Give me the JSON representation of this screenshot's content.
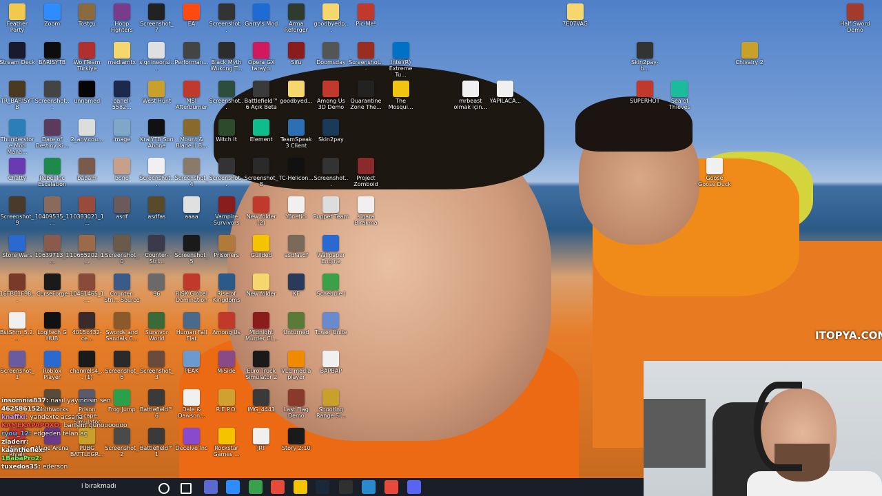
{
  "desktop_icons": [
    {
      "label": "Feather Party",
      "color": "#f2c94c"
    },
    {
      "label": "Zoom",
      "color": "#2d8cff"
    },
    {
      "label": "Tostçu",
      "color": "#8b6a3e"
    },
    {
      "label": "Hoop Fighters",
      "color": "#7a3b8a"
    },
    {
      "label": "Screenshot_7",
      "color": "#222222"
    },
    {
      "label": "EA",
      "color": "#ff4a12"
    },
    {
      "label": "Screenshot...",
      "color": "#333333"
    },
    {
      "label": "Garry's Mod",
      "color": "#1e6bd6"
    },
    {
      "label": "Arma Reforger",
      "color": "#2f3b2f"
    },
    {
      "label": "goodbyedp...",
      "color": "#f5d76e"
    },
    {
      "label": "Pic-Me!",
      "color": "#c0392b"
    },
    {
      "label": "7E07VAG",
      "color": "#f5d76e"
    },
    {
      "label": "Half Sword Demo",
      "color": "#a33a2a"
    },
    {
      "label": "Stream Deck",
      "color": "#1a1a2e"
    },
    {
      "label": "BARISYTB",
      "color": "#0d0d0d"
    },
    {
      "label": "WolfTeam Türkiye",
      "color": "#b03030"
    },
    {
      "label": "mediamtx",
      "color": "#f5d76e"
    },
    {
      "label": "signineonsi...",
      "color": "#e0e0e0"
    },
    {
      "label": "Performan...",
      "color": "#444444"
    },
    {
      "label": "Black Myth Wukong T...",
      "color": "#2c2c2c"
    },
    {
      "label": "Opera GX taraycı",
      "color": "#d3195e"
    },
    {
      "label": "Sifu",
      "color": "#8a1c1c"
    },
    {
      "label": "Doomsday",
      "color": "#555555"
    },
    {
      "label": "Screenshot...",
      "color": "#9b2d20"
    },
    {
      "label": "Intel(R) Extreme Tu...",
      "color": "#0071c5"
    },
    {
      "label": "Skin2pay-b...",
      "color": "#333333"
    },
    {
      "label": "Chivalry 2",
      "color": "#c8a02a"
    },
    {
      "label": "TR_BARISYTB",
      "color": "#4a3a20"
    },
    {
      "label": "Screenshot...",
      "color": "#444444"
    },
    {
      "label": "unnamed",
      "color": "#050505"
    },
    {
      "label": "panel-5582...",
      "color": "#1b2a4a"
    },
    {
      "label": "West Hunt",
      "color": "#c8a02a"
    },
    {
      "label": "MSI Afterburner",
      "color": "#c0392b"
    },
    {
      "label": "Screenshot...",
      "color": "#2d4d3d"
    },
    {
      "label": "Battlefield™ 6 Açık Beta",
      "color": "#3a3a3a"
    },
    {
      "label": "goodbyed...",
      "color": "#f5d76e"
    },
    {
      "label": "Among Us 3D Demo",
      "color": "#c0392b"
    },
    {
      "label": "Quarantine Zone The...",
      "color": "#222222"
    },
    {
      "label": "The Mosqui...",
      "color": "#f1c40f"
    },
    {
      "label": "mrbeast olmak için...",
      "color": "#f0f0f0"
    },
    {
      "label": "YAPILACA...",
      "color": "#f0f0f0"
    },
    {
      "label": "SUPERHOT",
      "color": "#c0392b"
    },
    {
      "label": "Sea of Thieves",
      "color": "#1abc9c"
    },
    {
      "label": "Thunderstore Mod Mana...",
      "color": "#2980b9"
    },
    {
      "label": "Date of Destiny Ki...",
      "color": "#5b3a5b"
    },
    {
      "label": "2_any.cou...",
      "color": "#dddddd"
    },
    {
      "label": "image",
      "color": "#7fa8c8"
    },
    {
      "label": "KralYTB Son Abone",
      "color": "#111111"
    },
    {
      "label": "Mount & Blade II B...",
      "color": "#8a6a2a"
    },
    {
      "label": "Witch It",
      "color": "#2d4a2d"
    },
    {
      "label": "Element",
      "color": "#0dbd8b"
    },
    {
      "label": "TeamSpeak 3 Client",
      "color": "#2c6fb5"
    },
    {
      "label": "Skin2pay",
      "color": "#1b3a5a"
    },
    {
      "label": "Chatty",
      "color": "#6a3ab0"
    },
    {
      "label": "Rebel Inc Escalation",
      "color": "#1e8a4a"
    },
    {
      "label": "babam",
      "color": "#7a5a4a"
    },
    {
      "label": "bono",
      "color": "#c8a08a"
    },
    {
      "label": "Screenshot...",
      "color": "#f0f0f0"
    },
    {
      "label": "Screenshot_4",
      "color": "#8a7a6a"
    },
    {
      "label": "Screenshot...",
      "color": "#333333"
    },
    {
      "label": "Screenshot_8",
      "color": "#2a2a2a"
    },
    {
      "label": "TC-Helicon...",
      "color": "#111111"
    },
    {
      "label": "Screenshot...",
      "color": "#333333"
    },
    {
      "label": "Project Zomboid",
      "color": "#8a2a2a"
    },
    {
      "label": "Goose Goose Duck",
      "color": "#f0f0f0"
    },
    {
      "label": "Screenshot_9",
      "color": "#4a3a2a"
    },
    {
      "label": "10409535_1...",
      "color": "#8a6a5a"
    },
    {
      "label": "10383021_1...",
      "color": "#9a4a3a"
    },
    {
      "label": "asdf",
      "color": "#6a5a5a"
    },
    {
      "label": "asdfas",
      "color": "#5a4a2a"
    },
    {
      "label": "aaaa",
      "color": "#e0e0e0"
    },
    {
      "label": "Vampire Survivors",
      "color": "#8a1c1c"
    },
    {
      "label": "New folder (2)",
      "color": "#c0392b"
    },
    {
      "label": "Yönetici",
      "color": "#f0f0f0"
    },
    {
      "label": "Puppet Team",
      "color": "#dddddd"
    },
    {
      "label": "sigara Bırakma",
      "color": "#f0f0f0"
    },
    {
      "label": "Store Wars",
      "color": "#2a6ad0"
    },
    {
      "label": "10639713_1...",
      "color": "#8a5a4a"
    },
    {
      "label": "10665202_1...",
      "color": "#9a6a4a"
    },
    {
      "label": "Screenshot_0",
      "color": "#6a5a4a"
    },
    {
      "label": "Counter-Stri...",
      "color": "#3a3a4a"
    },
    {
      "label": "Screenshot_5",
      "color": "#1a1a1a"
    },
    {
      "label": "Prisoners",
      "color": "#b07a3a"
    },
    {
      "label": "Guilded",
      "color": "#f5c400"
    },
    {
      "label": "asdfasdf",
      "color": "#7a6a5a"
    },
    {
      "label": "Wallpaper Engine",
      "color": "#2a6ad0"
    },
    {
      "label": "16FBC1F98...",
      "color": "#7a3a2a"
    },
    {
      "label": "CurseForge",
      "color": "#1a1a1a"
    },
    {
      "label": "10461465_1...",
      "color": "#8a4a3a"
    },
    {
      "label": "Counter-Stri... Source",
      "color": "#3a5a8a"
    },
    {
      "label": "96",
      "color": "#6a6a6a"
    },
    {
      "label": "RISK Global Domination",
      "color": "#c0392b"
    },
    {
      "label": "Rise of Kingdoms",
      "color": "#2a5a8a"
    },
    {
      "label": "New folder",
      "color": "#f5d76e"
    },
    {
      "label": "KF",
      "color": "#2a3a5a"
    },
    {
      "label": "Schedule I",
      "color": "#3aa04a"
    },
    {
      "label": "BstShm_5.2...",
      "color": "#f0f0f0"
    },
    {
      "label": "Logitech G HUB",
      "color": "#111111"
    },
    {
      "label": "4015c432-ce...",
      "color": "#3a2a2a"
    },
    {
      "label": "Swords and Sandals C...",
      "color": "#8a5a2a"
    },
    {
      "label": "Survivor World",
      "color": "#3a6a3a"
    },
    {
      "label": "Human Fall Flat",
      "color": "#4a6a8a"
    },
    {
      "label": "Among Us",
      "color": "#c0392b"
    },
    {
      "label": "Midnight Murder Cl...",
      "color": "#8a1c1c"
    },
    {
      "label": "Unturned",
      "color": "#5a7a3a"
    },
    {
      "label": "Tower Unite",
      "color": "#6a8ad0"
    },
    {
      "label": "Screenshot_1",
      "color": "#6a5aa0"
    },
    {
      "label": "Roblox Player",
      "color": "#2a6ad0"
    },
    {
      "label": "channels4_... (1)",
      "color": "#1a1a1a"
    },
    {
      "label": "Screenshot_6",
      "color": "#2a2a2a"
    },
    {
      "label": "Screenshot_3",
      "color": "#6a4a3a"
    },
    {
      "label": "PEAK",
      "color": "#6a9ad0"
    },
    {
      "label": "MiSide",
      "color": "#8a4a8a"
    },
    {
      "label": "Euro Truck Simulator 2",
      "color": "#1a1a1a"
    },
    {
      "label": "VLC media player",
      "color": "#f08a00"
    },
    {
      "label": "BAPBAP",
      "color": "#f0f0f0"
    },
    {
      "label": "Smithworks",
      "color": "#5a4a3a"
    },
    {
      "label": "Prison Escape Simulator D...",
      "color": "#5a5a6a"
    },
    {
      "label": "Frog Jump",
      "color": "#2aa04a"
    },
    {
      "label": "Battlefield™ 6",
      "color": "#3a3a3a"
    },
    {
      "label": "Dale & Dawson...",
      "color": "#f0f0f0"
    },
    {
      "label": "R.E.P.O.",
      "color": "#d0a030"
    },
    {
      "label": "IMG_4441",
      "color": "#3a3a3a"
    },
    {
      "label": "Last Flag Demo",
      "color": "#8a3a2a"
    },
    {
      "label": "Shooting Range Si...",
      "color": "#c8a02a"
    },
    {
      "label": "PUBG BATTLEGR...",
      "color": "#c8a02a"
    },
    {
      "label": "Screenshot_2",
      "color": "#4a4a4a"
    },
    {
      "label": "Battlefield™ 1",
      "color": "#3a3a3a"
    },
    {
      "label": "Deceive Inc",
      "color": "#8a4ad0"
    },
    {
      "label": "Rockstar Games ...",
      "color": "#f5c400"
    },
    {
      "label": "JRT",
      "color": "#f0f0f0"
    },
    {
      "label": "Story 2:10",
      "color": "#1a1a1a"
    },
    {
      "label": "Mage Arena",
      "color": "#6a3a8a"
    },
    {
      "label": "Marvel Rivals",
      "color": "#c0392b"
    }
  ],
  "watermark": "ITOPYA.COM",
  "chat": [
    {
      "user": "insomnia837",
      "message": "nasıl yayıncısın sen",
      "color": "#ffffff"
    },
    {
      "user": "462586152",
      "message": "",
      "color": "#ffffff"
    },
    {
      "user": "knaffxi",
      "message": "yandexte acsana",
      "color": "#c89aff"
    },
    {
      "user": "KAMEKAPAPOXO",
      "message": "barışım günooooooo",
      "color": "#ff4a4a"
    },
    {
      "user": "ryou_12",
      "message": "edgeden felan aç",
      "color": "#6ab0ff"
    },
    {
      "user": "zladerr",
      "message": "",
      "color": "#ffffff"
    },
    {
      "user": "kaantheflex",
      "message": "",
      "color": "#ffffff"
    },
    {
      "user": "1BabaPro2",
      "message": "",
      "color": "#6aff6a"
    },
    {
      "user": "tuxedos35",
      "message": "ederson",
      "color": "#ffffff"
    }
  ],
  "taskbar": {
    "notice": "i bırakmadı",
    "apps": [
      {
        "name": "start-icon",
        "color": "#ffffff"
      },
      {
        "name": "search-icon",
        "color": "#ffffff"
      },
      {
        "name": "task-view-icon",
        "color": "#ffffff"
      },
      {
        "name": "app-icon-1",
        "color": "#5a6ad0"
      },
      {
        "name": "app-icon-2",
        "color": "#2d8cff"
      },
      {
        "name": "calculator-icon",
        "color": "#3aa04a"
      },
      {
        "name": "chrome-icon",
        "color": "#e84a3a"
      },
      {
        "name": "folder-icon",
        "color": "#f5c400"
      },
      {
        "name": "steam-icon",
        "color": "#1b2838"
      },
      {
        "name": "obs-icon",
        "color": "#303030"
      },
      {
        "name": "app-icon-3",
        "color": "#2a8ad0"
      },
      {
        "name": "chrome-active-icon",
        "color": "#e84a3a"
      },
      {
        "name": "discord-icon",
        "color": "#5865f2"
      }
    ]
  }
}
